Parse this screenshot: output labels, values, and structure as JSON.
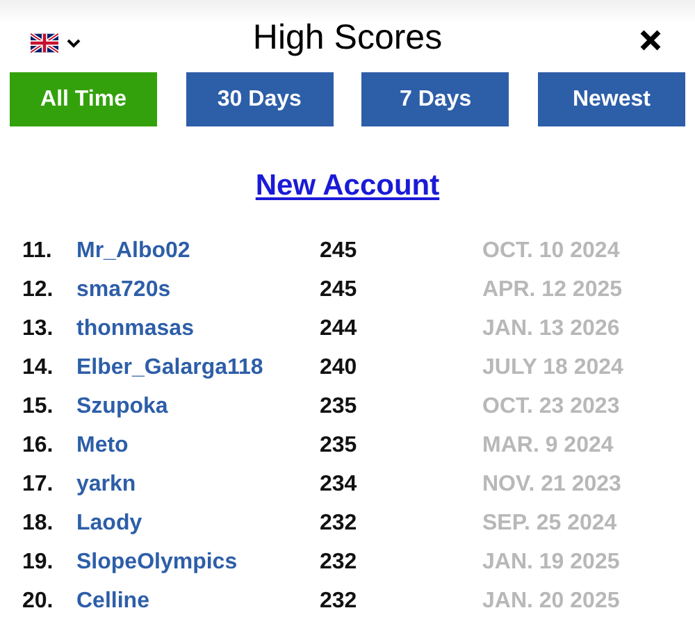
{
  "header": {
    "title": "High Scores"
  },
  "tabs": [
    {
      "label": "All Time",
      "selected": true
    },
    {
      "label": "30 Days",
      "selected": false
    },
    {
      "label": "7 Days",
      "selected": false
    },
    {
      "label": "Newest",
      "selected": false
    }
  ],
  "new_account_link": "New Account",
  "scores": [
    {
      "rank": "11.",
      "name": "Mr_Albo02",
      "score": "245",
      "date": "OCT. 10 2024"
    },
    {
      "rank": "12.",
      "name": "sma720s",
      "score": "245",
      "date": "APR. 12 2025"
    },
    {
      "rank": "13.",
      "name": "thonmasas",
      "score": "244",
      "date": "JAN. 13 2026"
    },
    {
      "rank": "14.",
      "name": "Elber_Galarga118",
      "score": "240",
      "date": "JULY 18 2024"
    },
    {
      "rank": "15.",
      "name": "Szupoka",
      "score": "235",
      "date": "OCT. 23 2023"
    },
    {
      "rank": "16.",
      "name": "Meto",
      "score": "235",
      "date": "MAR. 9 2024"
    },
    {
      "rank": "17.",
      "name": "yarkn",
      "score": "234",
      "date": "NOV. 21 2023"
    },
    {
      "rank": "18.",
      "name": "Laody",
      "score": "232",
      "date": "SEP. 25 2024"
    },
    {
      "rank": "19.",
      "name": "SlopeOlympics",
      "score": "232",
      "date": "JAN. 19 2025"
    },
    {
      "rank": "20.",
      "name": "Celline",
      "score": "232",
      "date": "JAN. 20 2025"
    }
  ]
}
